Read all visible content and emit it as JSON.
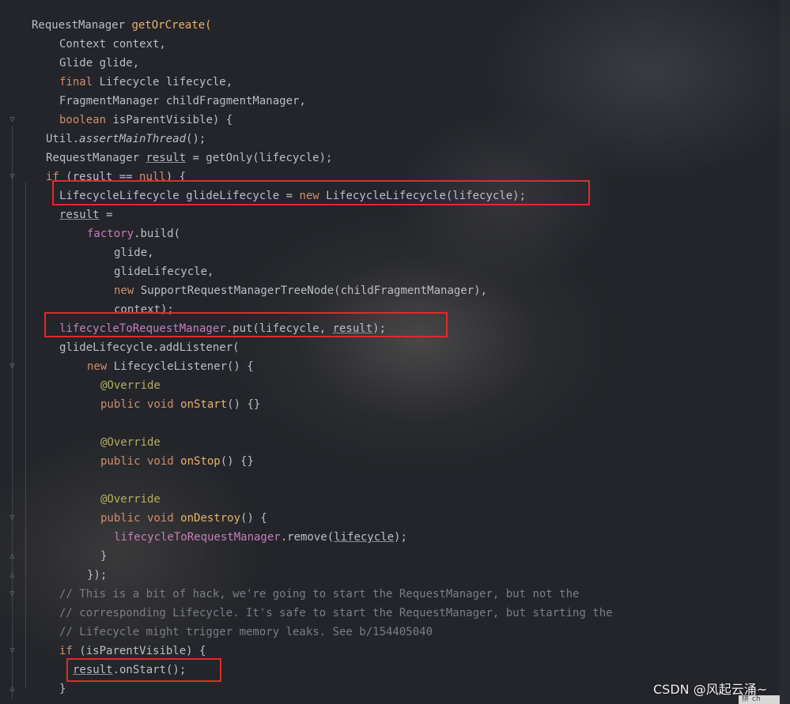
{
  "editor": {
    "lines": [
      {
        "tokens": [
          {
            "t": "RequestManager ",
            "c": ""
          },
          {
            "t": "getOrCreate",
            "c": "fn"
          },
          {
            "t": "(",
            "c": "fn"
          }
        ]
      },
      {
        "tokens": [
          {
            "t": "Context context,",
            "c": ""
          }
        ]
      },
      {
        "tokens": [
          {
            "t": "Glide glide,",
            "c": ""
          }
        ]
      },
      {
        "tokens": [
          {
            "t": "final ",
            "c": "k"
          },
          {
            "t": "Lifecycle lifecycle,",
            "c": ""
          }
        ]
      },
      {
        "tokens": [
          {
            "t": "FragmentManager childFragmentManager,",
            "c": ""
          }
        ]
      },
      {
        "tokens": [
          {
            "t": "boolean ",
            "c": "k"
          },
          {
            "t": "isParentVisible) {",
            "c": ""
          }
        ]
      },
      {
        "tokens": [
          {
            "t": "Util.",
            "c": ""
          },
          {
            "t": "assertMainThread",
            "c": "it"
          },
          {
            "t": "();",
            "c": ""
          }
        ]
      },
      {
        "tokens": [
          {
            "t": "RequestManager ",
            "c": ""
          },
          {
            "t": "result",
            "c": "u"
          },
          {
            "t": " = getOnly(lifecycle);",
            "c": ""
          }
        ]
      },
      {
        "tokens": [
          {
            "t": "if ",
            "c": "k"
          },
          {
            "t": "(result == ",
            "c": ""
          },
          {
            "t": "null",
            "c": "k"
          },
          {
            "t": ") {",
            "c": ""
          }
        ]
      },
      {
        "tokens": [
          {
            "t": "LifecycleLifecycle glideLifecycle = ",
            "c": ""
          },
          {
            "t": "new ",
            "c": "k"
          },
          {
            "t": "LifecycleLifecycle(lifecycle);",
            "c": ""
          }
        ]
      },
      {
        "tokens": [
          {
            "t": "result",
            "c": "u"
          },
          {
            "t": " =",
            "c": ""
          }
        ]
      },
      {
        "tokens": [
          {
            "t": "factory",
            "c": "f"
          },
          {
            "t": ".build(",
            "c": ""
          }
        ]
      },
      {
        "tokens": [
          {
            "t": "glide,",
            "c": ""
          }
        ]
      },
      {
        "tokens": [
          {
            "t": "glideLifecycle,",
            "c": ""
          }
        ]
      },
      {
        "tokens": [
          {
            "t": "new ",
            "c": "k"
          },
          {
            "t": "SupportRequestManagerTreeNode(childFragmentManager),",
            "c": ""
          }
        ]
      },
      {
        "tokens": [
          {
            "t": "context);",
            "c": ""
          }
        ]
      },
      {
        "tokens": [
          {
            "t": "lifecycleToRequestManager",
            "c": "f"
          },
          {
            "t": ".put(lifecycle, ",
            "c": ""
          },
          {
            "t": "result",
            "c": "u"
          },
          {
            "t": ");",
            "c": ""
          }
        ]
      },
      {
        "tokens": [
          {
            "t": "glideLifecycle.addListener(",
            "c": ""
          }
        ]
      },
      {
        "tokens": [
          {
            "t": "new ",
            "c": "k"
          },
          {
            "t": "LifecycleListener() {",
            "c": ""
          }
        ]
      },
      {
        "tokens": [
          {
            "t": "@Override",
            "c": "an"
          }
        ]
      },
      {
        "tokens": [
          {
            "t": "public void ",
            "c": "k"
          },
          {
            "t": "onStart",
            "c": "fn"
          },
          {
            "t": "() {}",
            "c": ""
          }
        ]
      },
      {
        "tokens": []
      },
      {
        "tokens": [
          {
            "t": "@Override",
            "c": "an"
          }
        ]
      },
      {
        "tokens": [
          {
            "t": "public void ",
            "c": "k"
          },
          {
            "t": "onStop",
            "c": "fn"
          },
          {
            "t": "() {}",
            "c": ""
          }
        ]
      },
      {
        "tokens": []
      },
      {
        "tokens": [
          {
            "t": "@Override",
            "c": "an"
          }
        ]
      },
      {
        "tokens": [
          {
            "t": "public void ",
            "c": "k"
          },
          {
            "t": "onDestroy",
            "c": "fn"
          },
          {
            "t": "() {",
            "c": ""
          }
        ]
      },
      {
        "tokens": [
          {
            "t": "lifecycleToRequestManager",
            "c": "f"
          },
          {
            "t": ".remove(",
            "c": ""
          },
          {
            "t": "lifecycle",
            "c": "u"
          },
          {
            "t": ");",
            "c": ""
          }
        ]
      },
      {
        "tokens": [
          {
            "t": "}",
            "c": ""
          }
        ]
      },
      {
        "tokens": [
          {
            "t": "});",
            "c": ""
          }
        ]
      },
      {
        "tokens": [
          {
            "t": "// This is a bit of hack, we're going to start the RequestManager, but not the",
            "c": "cm"
          }
        ]
      },
      {
        "tokens": [
          {
            "t": "// corresponding Lifecycle. It's safe to start the RequestManager, but starting the",
            "c": "cm"
          }
        ]
      },
      {
        "tokens": [
          {
            "t": "// Lifecycle might trigger memory leaks. See b/154405040",
            "c": "cm"
          }
        ]
      },
      {
        "tokens": [
          {
            "t": "if ",
            "c": "k"
          },
          {
            "t": "(isParentVisible) {",
            "c": ""
          }
        ]
      },
      {
        "tokens": [
          {
            "t": "result",
            "c": "u"
          },
          {
            "t": ".onStart();",
            "c": ""
          }
        ]
      },
      {
        "tokens": [
          {
            "t": "}",
            "c": ""
          }
        ]
      }
    ]
  },
  "highlights": [
    {
      "name": "highlight-glide-lifecycle"
    },
    {
      "name": "highlight-put-result"
    },
    {
      "name": "highlight-onstart"
    }
  ],
  "watermark": "CSDN @风起云涌~",
  "ime_bar": {
    "left": "拼",
    "right": "ch"
  }
}
